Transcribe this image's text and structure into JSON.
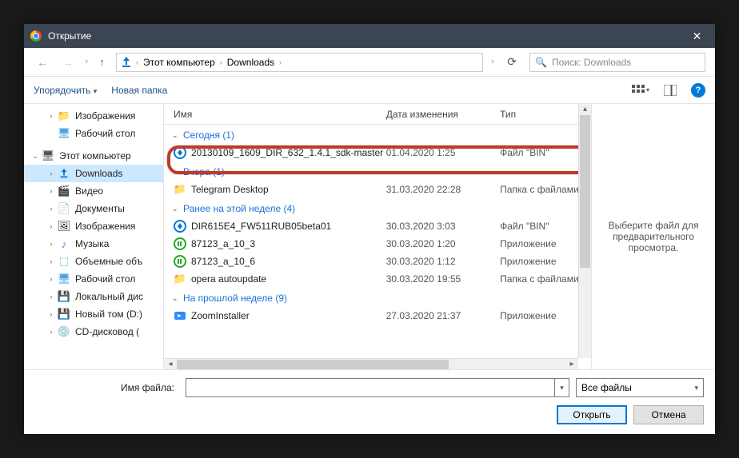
{
  "titlebar": {
    "title": "Открытие"
  },
  "nav": {
    "crumb1": "Этот компьютер",
    "crumb2": "Downloads",
    "search_placeholder": "Поиск: Downloads"
  },
  "toolbar": {
    "organize": "Упорядочить",
    "new_folder": "Новая папка"
  },
  "sidebar": {
    "images": "Изображения",
    "desktop": "Рабочий стол",
    "this_pc": "Этот компьютер",
    "downloads": "Downloads",
    "videos": "Видео",
    "documents": "Документы",
    "images2": "Изображения",
    "music": "Музыка",
    "objects3d": "Объемные объ",
    "desktop2": "Рабочий стол",
    "local_disk": "Локальный дис",
    "new_volume": "Новый том (D:)",
    "cd_drive": "CD-дисковод ("
  },
  "columns": {
    "name": "Имя",
    "date": "Дата изменения",
    "type": "Тип"
  },
  "groups": {
    "today": "Сегодня (1)",
    "yesterday": "Вчера (1)",
    "earlier_week": "Ранее на этой неделе (4)",
    "last_week": "На прошлой неделе (9)"
  },
  "files": {
    "today": [
      {
        "name": "20130109_1609_DIR_632_1.4.1_sdk-master",
        "date": "01.04.2020 1:25",
        "type": "Файл \"BIN\"",
        "icon": "bin"
      }
    ],
    "yesterday": [
      {
        "name": "Telegram Desktop",
        "date": "31.03.2020 22:28",
        "type": "Папка с файлами",
        "icon": "folder"
      }
    ],
    "earlier_week": [
      {
        "name": "DIR615E4_FW511RUB05beta01",
        "date": "30.03.2020 3:03",
        "type": "Файл \"BIN\"",
        "icon": "bin"
      },
      {
        "name": "87123_a_10_3",
        "date": "30.03.2020 1:20",
        "type": "Приложение",
        "icon": "app"
      },
      {
        "name": "87123_a_10_6",
        "date": "30.03.2020 1:12",
        "type": "Приложение",
        "icon": "app"
      },
      {
        "name": "opera autoupdate",
        "date": "30.03.2020 19:55",
        "type": "Папка с файлами",
        "icon": "folder"
      }
    ],
    "last_week": [
      {
        "name": "ZoomInstaller",
        "date": "27.03.2020 21:37",
        "type": "Приложение",
        "icon": "zoom"
      }
    ]
  },
  "preview": {
    "text": "Выберите файл для предварительного просмотра."
  },
  "footer": {
    "filename_label": "Имя файла:",
    "type_filter": "Все файлы",
    "open": "Открыть",
    "cancel": "Отмена"
  }
}
